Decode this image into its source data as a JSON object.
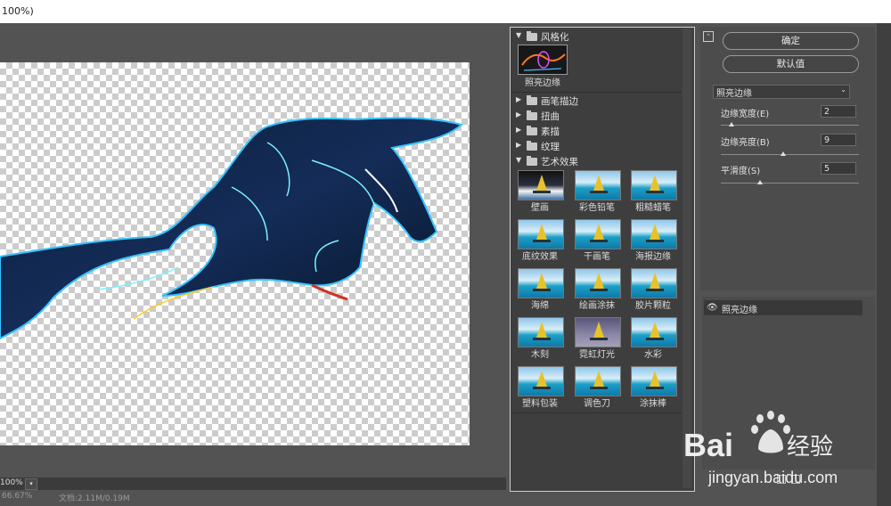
{
  "window": {
    "title_fragment": "100%)"
  },
  "preview": {
    "zoom_value": "100%",
    "zoom_dropdown_icon": "chevron-down-icon",
    "status_zoom": "66.67%",
    "status_doc": "文档:2.11M/0.19M"
  },
  "gallery": {
    "groups": [
      {
        "label": "风格化",
        "expanded": true
      },
      {
        "label": "画笔描边",
        "expanded": false
      },
      {
        "label": "扭曲",
        "expanded": false
      },
      {
        "label": "素描",
        "expanded": false
      },
      {
        "label": "纹理",
        "expanded": false
      },
      {
        "label": "艺术效果",
        "expanded": true
      }
    ],
    "stylize_items": [
      {
        "label": "照亮边缘",
        "selected": true
      }
    ],
    "artistic_items": [
      {
        "label": "壁画"
      },
      {
        "label": "彩色铅笔"
      },
      {
        "label": "粗糙蜡笔"
      },
      {
        "label": "底纹效果"
      },
      {
        "label": "干画笔"
      },
      {
        "label": "海报边缘"
      },
      {
        "label": "海绵"
      },
      {
        "label": "绘画涂抹"
      },
      {
        "label": "胶片颗粒"
      },
      {
        "label": "木刻"
      },
      {
        "label": "霓虹灯光"
      },
      {
        "label": "水彩"
      },
      {
        "label": "塑料包装"
      },
      {
        "label": "调色刀"
      },
      {
        "label": "涂抹棒"
      }
    ]
  },
  "settings": {
    "ok_label": "确定",
    "default_label": "默认值",
    "filter_selected": "照亮边缘",
    "params": [
      {
        "label": "边缘宽度(E)",
        "value": "2",
        "min": 1,
        "max": 14
      },
      {
        "label": "边缘亮度(B)",
        "value": "9",
        "min": 0,
        "max": 20
      },
      {
        "label": "平滑度(S)",
        "value": "5",
        "min": 1,
        "max": 15
      }
    ]
  },
  "layers": {
    "items": [
      {
        "label": "照亮边缘",
        "visible": true
      }
    ]
  },
  "watermark": {
    "brand": "Bai",
    "brand2": "经验",
    "url": "jingyan.baidu.com"
  },
  "colors": {
    "panel_bg": "#535353",
    "gallery_bg": "#3e3e3e",
    "watermark": "#ffffff"
  }
}
